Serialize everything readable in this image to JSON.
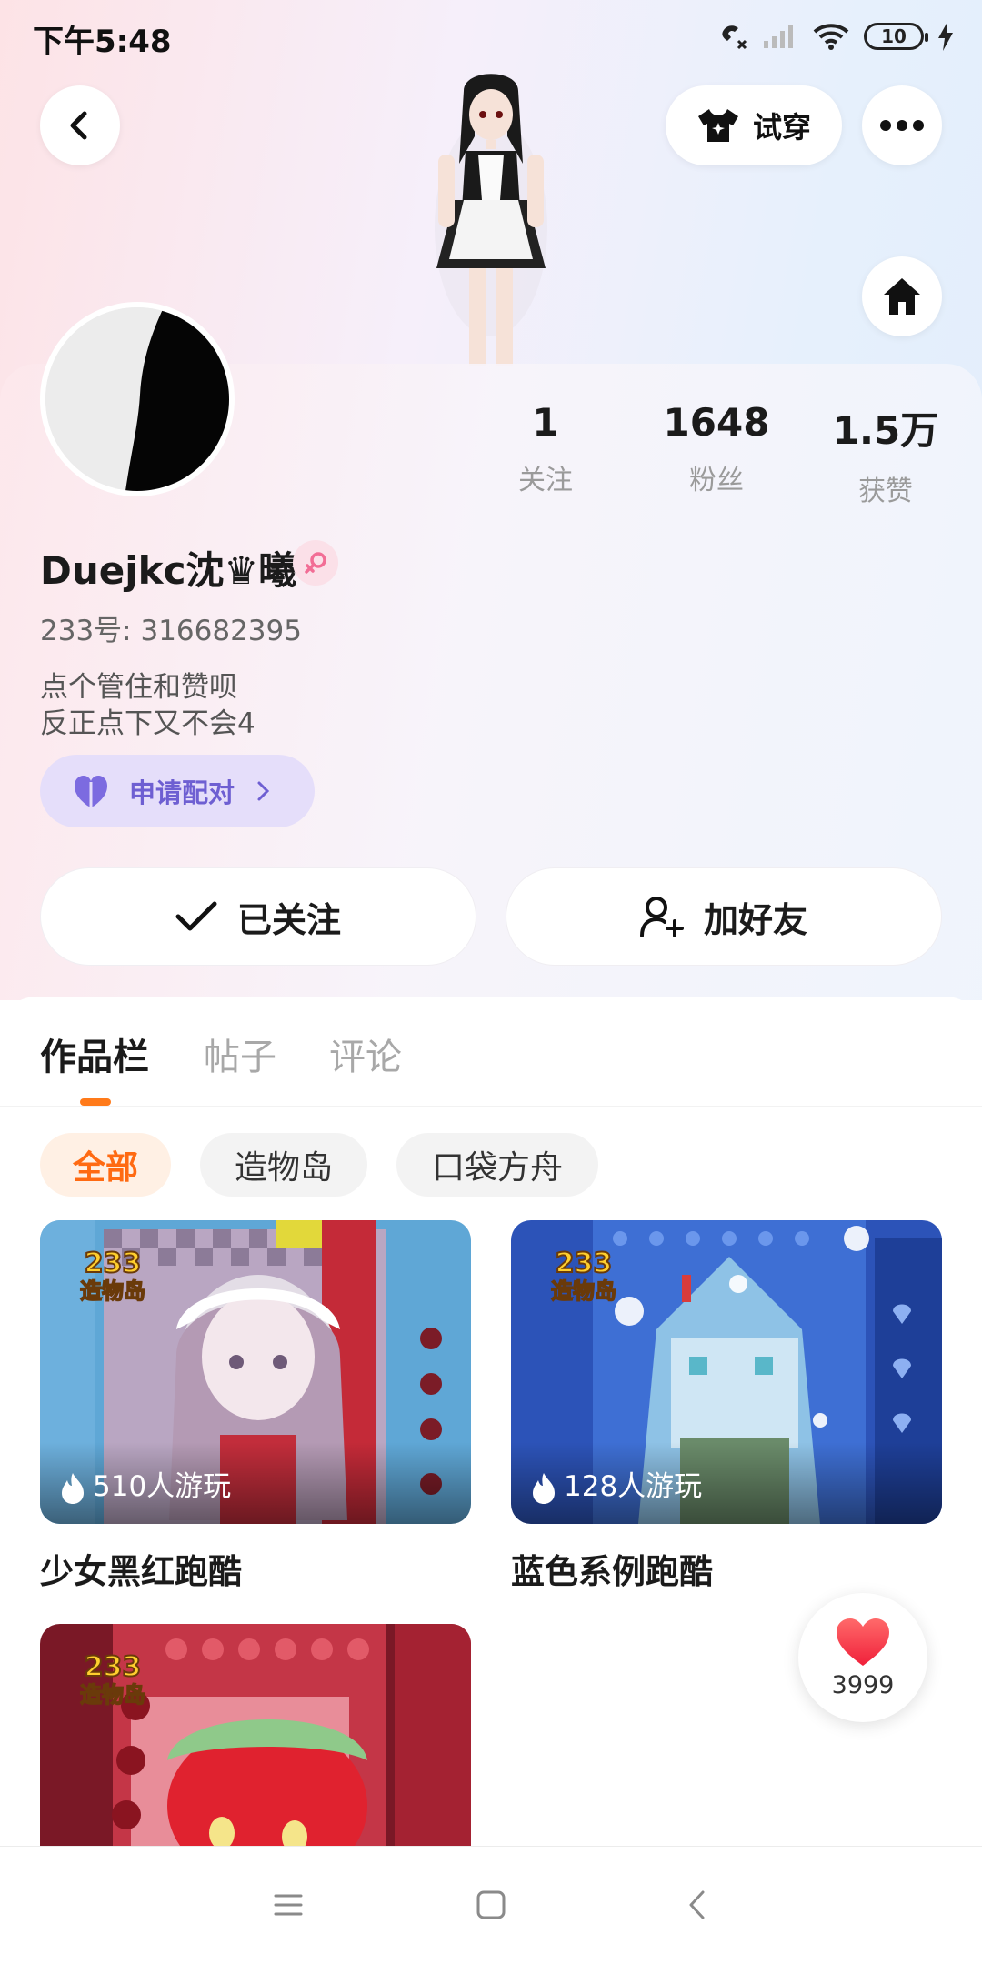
{
  "status_bar": {
    "time": "下午5:48",
    "battery": "10"
  },
  "header": {
    "try_on_label": "试穿",
    "icons": [
      "back-icon",
      "shirt-icon",
      "more-icon",
      "home-icon"
    ]
  },
  "profile": {
    "stats": [
      {
        "value": "1",
        "label": "关注"
      },
      {
        "value": "1648",
        "label": "粉丝"
      },
      {
        "value": "1.5万",
        "label": "获赞"
      }
    ],
    "username": "Duejkc沈♛曦",
    "uid": "233号: 316682395",
    "bio_line1": "点个管住和赞呗",
    "bio_line2": "反正点下又不会4",
    "pair_label": "申请配对"
  },
  "actions": {
    "follow_label": "已关注",
    "add_friend_label": "加好友"
  },
  "tabs": {
    "works": "作品栏",
    "posts": "帖子",
    "comments": "评论",
    "active": "作品栏"
  },
  "filters": {
    "all": "全部",
    "zaowu": "造物岛",
    "koudai": "口袋方舟",
    "active": "全部"
  },
  "works": [
    {
      "title": "少女黑红跑酷",
      "plays": "510人游玩",
      "badge_line1": "233",
      "badge_line2": "造物岛"
    },
    {
      "title": "蓝色系例跑酷",
      "plays": "128人游玩",
      "badge_line1": "233",
      "badge_line2": "造物岛"
    },
    {
      "title": "",
      "plays": "",
      "badge_line1": "233",
      "badge_line2": "造物岛"
    }
  ],
  "like_float": {
    "count": "3999"
  },
  "colors": {
    "accent": "#ff7a1a",
    "pair_bg": "#e5defa",
    "pair_text": "#6e5fd2",
    "like_red": "#ff3b4a"
  }
}
